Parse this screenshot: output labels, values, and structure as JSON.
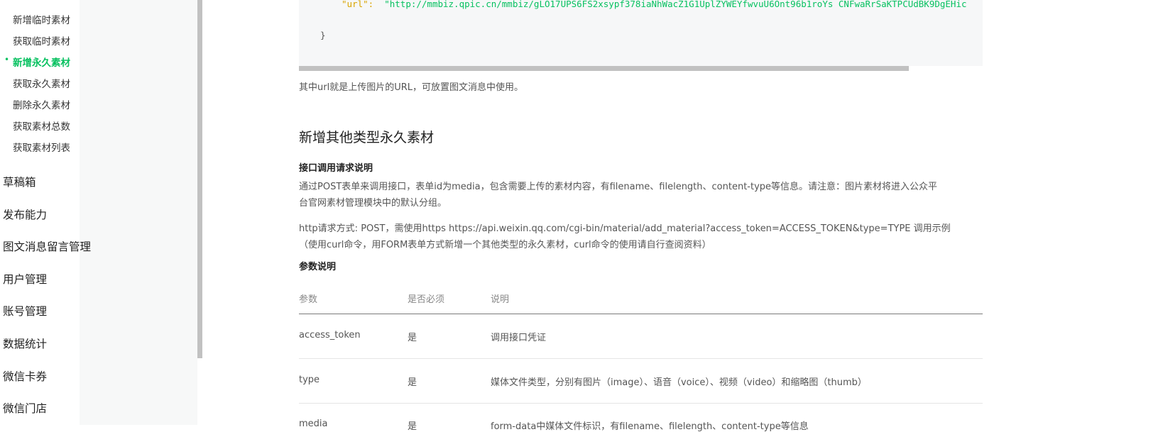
{
  "sidebar": {
    "sub_items": [
      {
        "label": "新增临时素材",
        "active": false
      },
      {
        "label": "获取临时素材",
        "active": false
      },
      {
        "label": "新增永久素材",
        "active": true
      },
      {
        "label": "获取永久素材",
        "active": false
      },
      {
        "label": "删除永久素材",
        "active": false
      },
      {
        "label": "获取素材总数",
        "active": false
      },
      {
        "label": "获取素材列表",
        "active": false
      }
    ],
    "bullet": "•",
    "top_items": [
      "草稿箱",
      "发布能力",
      "图文消息留言管理",
      "用户管理",
      "账号管理",
      "数据统计",
      "微信卡券",
      "微信门店"
    ]
  },
  "code": {
    "key": "\"url\":",
    "value": "\"http://mmbiz.qpic.cn/mmbiz/gLO17UPS6FS2xsypf378iaNhWacZ1G1UplZYWEYfwvuU6Ont96b1roYs CNFwaRrSaKTPCUdBK9DgEHic",
    "brace": "}"
  },
  "main": {
    "url_note": "其中url就是上传图片的URL，可放置图文消息中使用。",
    "section_title": "新增其他类型永久素材",
    "request_title": "接口调用请求说明",
    "desc_line1": "通过POST表单来调用接口，表单id为media，包含需要上传的素材内容，有filename、filelength、content-type等信息。请注意：图片素材将进入公众平",
    "desc_line2": "台官网素材管理模块中的默认分组。",
    "http_line1": "http请求方式: POST，需使用https https://api.weixin.qq.com/cgi-bin/material/add_material?access_token=ACCESS_TOKEN&type=TYPE 调用示例",
    "http_line2": "（使用curl命令，用FORM表单方式新增一个其他类型的永久素材，curl命令的使用请自行查阅资料）",
    "params_title": "参数说明"
  },
  "table": {
    "headers": [
      "参数",
      "是否必须",
      "说明"
    ],
    "rows": [
      [
        "access_token",
        "是",
        "调用接口凭证"
      ],
      [
        "type",
        "是",
        "媒体文件类型，分别有图片（image）、语音（voice）、视频（video）和缩略图（thumb）"
      ],
      [
        "media",
        "是",
        "form-data中媒体文件标识，有filename、filelength、content-type等信息"
      ]
    ]
  }
}
